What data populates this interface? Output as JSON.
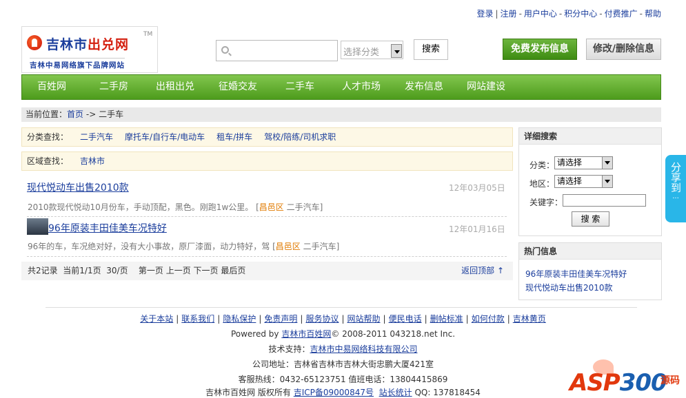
{
  "toplinks": {
    "login": "登录",
    "register": "注册",
    "user_center": "用户中心",
    "points_center": "积分中心",
    "paid_promo": "付费推广",
    "help": "帮助"
  },
  "logo": {
    "name_a": "吉林市",
    "name_b": "出兑网",
    "tm": "TM",
    "sub": "吉林中易网络旗下品牌网站"
  },
  "search": {
    "placeholder": "",
    "category_placeholder": "选择分类",
    "button": "搜索"
  },
  "actions": {
    "publish": "免费发布信息",
    "edit": "修改/删除信息"
  },
  "nav": [
    "百姓网",
    "二手房",
    "出租出兑",
    "征婚交友",
    "二手车",
    "人才市场",
    "发布信息",
    "网站建设"
  ],
  "breadcrumb": {
    "prefix": "当前位置：",
    "home": "首页",
    "sep": "->",
    "current": "二手车"
  },
  "filters": {
    "category_label": "分类查找：",
    "categories": [
      "二手汽车",
      "摩托车/自行车/电动车",
      "租车/拼车",
      "驾校/陪练/司机求职"
    ],
    "area_label": "区域查找：",
    "areas": [
      "吉林市"
    ]
  },
  "listings": [
    {
      "title": "现代悦动车出售2010款",
      "date": "12年03月05日",
      "desc": "2010款现代悦动10月份车，手动顶配，黑色。刚跑1w公里。",
      "area": "昌邑区",
      "category": "二手汽车"
    },
    {
      "title": "96年原装丰田佳美车况特好",
      "date": "12年01月16日",
      "desc": "96年的车，车况绝对好，没有大小事故，原厂漆面，动力特好，驾",
      "area": "昌邑区",
      "category": "二手汽车"
    }
  ],
  "pager": {
    "total": "共2记录",
    "current": "当前1/1页",
    "per_page": "30/页",
    "first": "第一页",
    "prev": "上一页",
    "next": "下一页",
    "last": "最后页",
    "back_top": "返回顶部 ↑"
  },
  "adv_search": {
    "title": "详细搜索",
    "category_label": "分类：",
    "category_value": "请选择",
    "area_label": "地区：",
    "area_value": "请选择",
    "keyword_label": "关键字：",
    "keyword_value": "",
    "button": "搜 索"
  },
  "hot": {
    "title": "热门信息",
    "items": [
      "96年原装丰田佳美车况特好",
      "现代悦动车出售2010款"
    ]
  },
  "share": {
    "label": "分享到",
    "dots": "···"
  },
  "footer": {
    "links": [
      "关于本站",
      "联系我们",
      "隐私保护",
      "免责声明",
      "服务协议",
      "网站帮助",
      "便民电话",
      "删帖标准",
      "如何付款",
      "吉林黄页"
    ],
    "powered_prefix": "Powered by ",
    "powered_link": "吉林市百姓网",
    "powered_suffix": "© 2008-2011 043218.net Inc.",
    "tech_prefix": "技术支持：",
    "tech_link": "吉林市中易网络科技有限公司",
    "address": "公司地址：吉林省吉林市吉林大街忠鹏大厦421室",
    "hotline": "客服热线：0432-65123751  值班电话：13804415869",
    "copyright_prefix": "吉林市百姓网 版权所有 ",
    "icp_link": "吉ICP备09000847号",
    "stats_link": "站长统计",
    "qq": " QQ: 137818454"
  },
  "watermark": {
    "asp": "ASP",
    "num": "300",
    "mark": "源码"
  },
  "colors": {
    "nav_green": "#5aa826",
    "link_blue": "#1a3d9c",
    "area_orange": "#e07a00",
    "share_blue": "#29b6e8"
  }
}
